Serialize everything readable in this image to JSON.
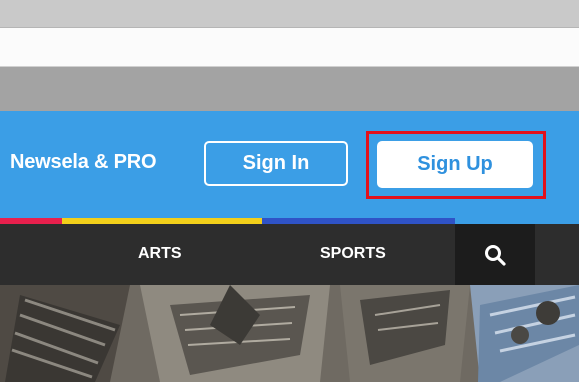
{
  "header": {
    "brand": "Newsela & PRO",
    "sign_in_label": "Sign In",
    "sign_up_label": "Sign Up",
    "background_color": "#3b9ee6",
    "highlight_color": "#e2101c"
  },
  "stripe_colors": [
    "#e8204d",
    "#f2cf1a",
    "#2f53c7",
    "#3b9ee6"
  ],
  "nav": {
    "items": [
      {
        "label": "ARTS"
      },
      {
        "label": "SPORTS"
      }
    ],
    "search_icon": "search-icon",
    "background_color": "#2d2d2d"
  },
  "hero": {
    "icon": "hero-photo"
  }
}
